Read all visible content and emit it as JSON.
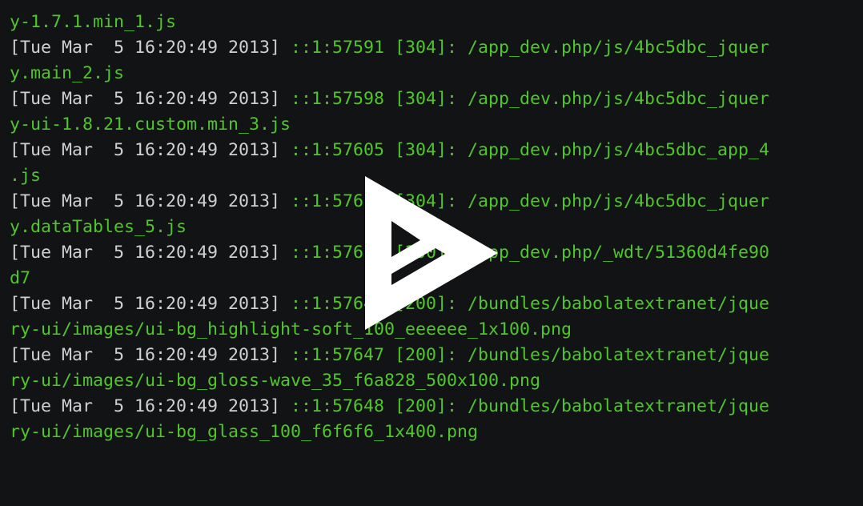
{
  "terminal": {
    "lines": [
      {
        "ts": "",
        "text": "y-1.7.1.min_1.js"
      },
      {
        "ts": "[Tue Mar  5 16:20:49 2013] ",
        "text": "::1:57591 [304]: /app_dev.php/js/4bc5dbc_jquer"
      },
      {
        "ts": "",
        "text": "y.main_2.js"
      },
      {
        "ts": "[Tue Mar  5 16:20:49 2013] ",
        "text": "::1:57598 [304]: /app_dev.php/js/4bc5dbc_jquer"
      },
      {
        "ts": "",
        "text": "y-ui-1.8.21.custom.min_3.js"
      },
      {
        "ts": "[Tue Mar  5 16:20:49 2013] ",
        "text": "::1:57605 [304]: /app_dev.php/js/4bc5dbc_app_4"
      },
      {
        "ts": "",
        "text": ".js"
      },
      {
        "ts": "[Tue Mar  5 16:20:49 2013] ",
        "text": "::1:57612 [304]: /app_dev.php/js/4bc5dbc_jquer"
      },
      {
        "ts": "",
        "text": "y.dataTables_5.js"
      },
      {
        "ts": "[Tue Mar  5 16:20:49 2013] ",
        "text": "::1:57619 [200]: /app_dev.php/_wdt/51360d4fe90"
      },
      {
        "ts": "",
        "text": "d7"
      },
      {
        "ts": "[Tue Mar  5 16:20:49 2013] ",
        "text": "::1:57646 [200]: /bundles/babolatextranet/jque"
      },
      {
        "ts": "",
        "text": "ry-ui/images/ui-bg_highlight-soft_100_eeeeee_1x100.png"
      },
      {
        "ts": "[Tue Mar  5 16:20:49 2013] ",
        "text": "::1:57647 [200]: /bundles/babolatextranet/jque"
      },
      {
        "ts": "",
        "text": "ry-ui/images/ui-bg_gloss-wave_35_f6a828_500x100.png"
      },
      {
        "ts": "[Tue Mar  5 16:20:49 2013] ",
        "text": "::1:57648 [200]: /bundles/babolatextranet/jque"
      },
      {
        "ts": "",
        "text": "ry-ui/images/ui-bg_glass_100_f6f6f6_1x400.png"
      }
    ]
  },
  "overlay": {
    "icon": "play-icon"
  },
  "colors": {
    "background": "#121314",
    "timestamp": "#d0d0d0",
    "log_text": "#4ec72a",
    "overlay": "#ffffff"
  }
}
